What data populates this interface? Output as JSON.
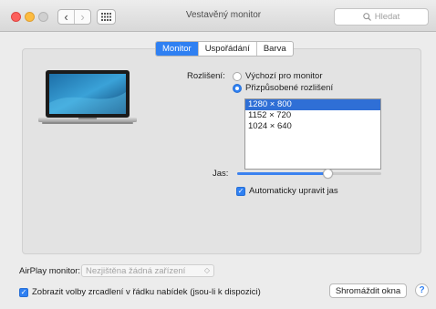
{
  "window": {
    "title": "Vestavěný monitor",
    "search_placeholder": "Hledat",
    "back_glyph": "‹",
    "forward_glyph": "›"
  },
  "tabs": [
    {
      "label": "Monitor",
      "active": true
    },
    {
      "label": "Uspořádání",
      "active": false
    },
    {
      "label": "Barva",
      "active": false
    }
  ],
  "resolution": {
    "label": "Rozlišení:",
    "option_default": "Výchozí pro monitor",
    "option_scaled": "Přizpůsobené rozlišení",
    "selected_option": "scaled",
    "list": [
      "1280 × 800",
      "1152 × 720",
      "1024 × 640"
    ],
    "selected_index": 0
  },
  "brightness": {
    "label": "Jas:",
    "level_percent": 63,
    "auto_label": "Automaticky upravit jas",
    "auto_checked": true
  },
  "airplay": {
    "label": "AirPlay monitor:",
    "value": "Nezjištěna žádná zařízení"
  },
  "mirroring": {
    "label": "Zobrazit volby zrcadlení v řádku nabídek (jsou-li k dispozici)",
    "checked": true
  },
  "buttons": {
    "gather": "Shromáždit okna",
    "help": "?"
  },
  "colors": {
    "accent": "#2f80f2",
    "close": "#fc605c",
    "minimize": "#fdbc40"
  }
}
